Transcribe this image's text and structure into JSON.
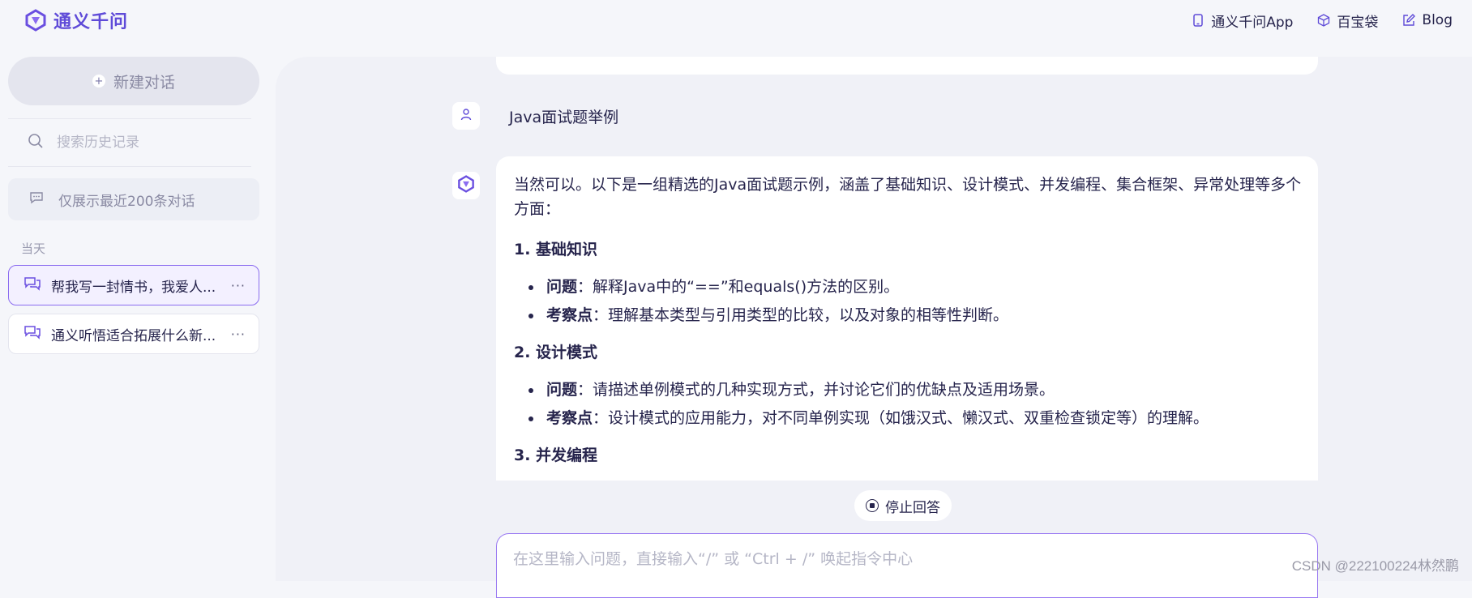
{
  "header": {
    "brand_name": "通义千问",
    "links": [
      {
        "label": "通义千问App",
        "icon": "phone-icon"
      },
      {
        "label": "百宝袋",
        "icon": "box-icon"
      },
      {
        "label": "Blog",
        "icon": "edit-icon"
      }
    ]
  },
  "sidebar": {
    "new_chat_label": "新建对话",
    "search_placeholder": "搜索历史记录",
    "notice": "仅展示最近200条对话",
    "section_label": "当天",
    "conversations": [
      {
        "label": "帮我写一封情书，我爱人...",
        "active": true
      },
      {
        "label": "通义听悟适合拓展什么新...",
        "active": false
      }
    ],
    "more_label": "···"
  },
  "chat": {
    "user_message": "Java面试题举例",
    "answer": {
      "intro": "当然可以。以下是一组精选的Java面试题示例，涵盖了基础知识、设计模式、并发编程、集合框架、异常处理等多个方面：",
      "sections": [
        {
          "heading": "1. 基础知识",
          "items": [
            {
              "term": "问题",
              "text": "：解释Java中的“==”和equals()方法的区别。"
            },
            {
              "term": "考察点",
              "text": "：理解基本类型与引用类型的比较，以及对象的相等性判断。"
            }
          ]
        },
        {
          "heading": "2. 设计模式",
          "items": [
            {
              "term": "问题",
              "text": "：请描述单例模式的几种实现方式，并讨论它们的优缺点及适用场景。"
            },
            {
              "term": "考察点",
              "text": "：设计模式的应用能力，对不同单例实现（如饿汉式、懒汉式、双重检查锁定等）的理解。"
            }
          ]
        },
        {
          "heading": "3. 并发编程",
          "items": []
        }
      ]
    },
    "stop_label": "停止回答",
    "input_placeholder": "在这里输入问题，直接输入“/” 或 “Ctrl + /” 唤起指令中心"
  },
  "watermark": "CSDN @222100224林然鹏",
  "colors": {
    "brand": "#5f4bd8",
    "accent_border": "#9a7af2"
  }
}
